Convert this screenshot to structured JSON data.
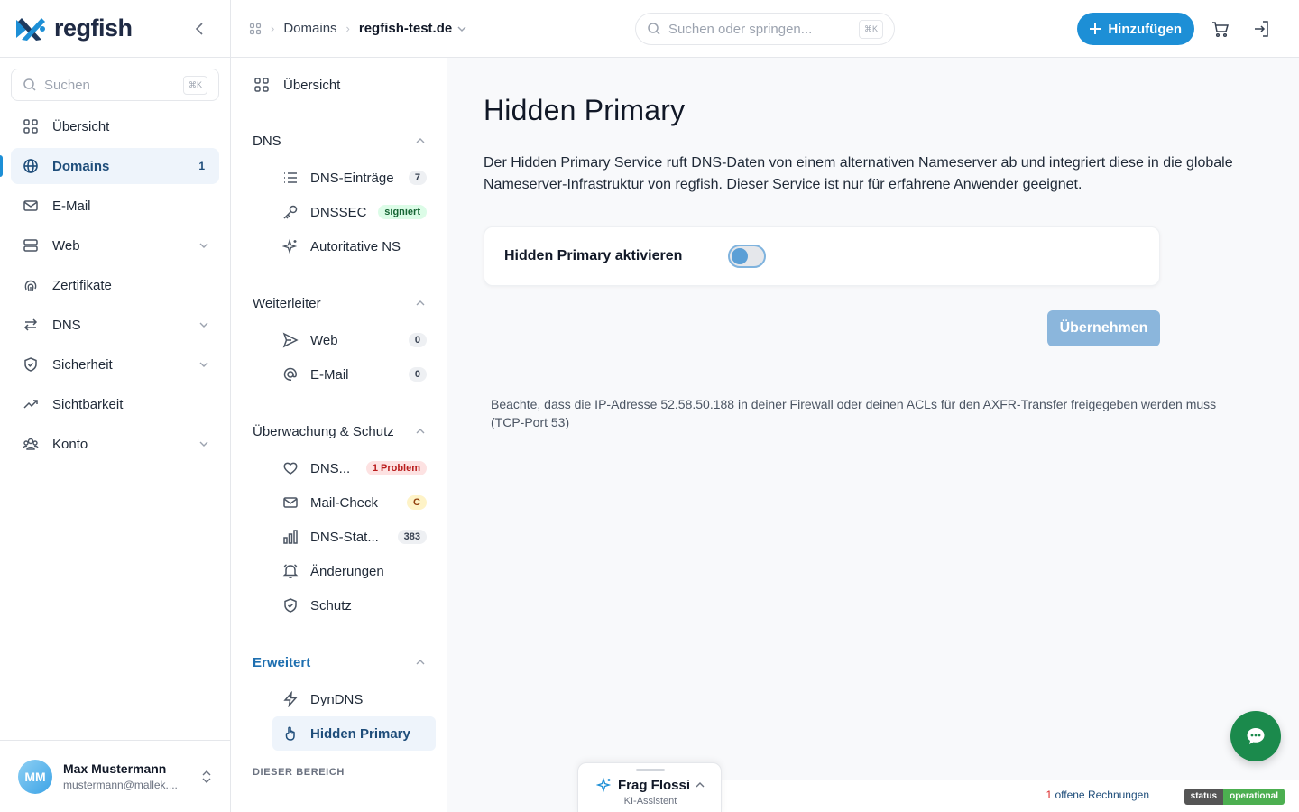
{
  "brand": {
    "name": "regfish"
  },
  "sidebar": {
    "search_placeholder": "Suchen",
    "search_shortcut": "⌘K",
    "items": [
      {
        "label": "Übersicht",
        "icon": "grid-icon"
      },
      {
        "label": "Domains",
        "icon": "globe-icon",
        "count": "1",
        "active": true
      },
      {
        "label": "E-Mail",
        "icon": "mail-icon"
      },
      {
        "label": "Web",
        "icon": "server-icon",
        "expandable": true
      },
      {
        "label": "Zertifikate",
        "icon": "fingerprint-icon"
      },
      {
        "label": "DNS",
        "icon": "arrows-icon",
        "expandable": true
      },
      {
        "label": "Sicherheit",
        "icon": "shield-icon",
        "expandable": true
      },
      {
        "label": "Sichtbarkeit",
        "icon": "trend-icon"
      },
      {
        "label": "Konto",
        "icon": "users-icon",
        "expandable": true
      }
    ]
  },
  "user": {
    "initials": "MM",
    "name": "Max Mustermann",
    "email": "mustermann@mallek...."
  },
  "topbar": {
    "breadcrumb": [
      "Domains",
      "regfish-test.de"
    ],
    "search_placeholder": "Suchen oder springen...",
    "search_shortcut": "⌘K",
    "add_label": "Hinzufügen"
  },
  "subnav": {
    "overview": "Übersicht",
    "sections": [
      {
        "title": "DNS",
        "items": [
          {
            "label": "DNS-Einträge",
            "badge": "7",
            "badge_style": "gray",
            "icon": "list-icon"
          },
          {
            "label": "DNSSEC",
            "badge": "signiert",
            "badge_style": "green",
            "icon": "key-icon"
          },
          {
            "label": "Autoritative NS",
            "icon": "sparkle-icon"
          }
        ]
      },
      {
        "title": "Weiterleiter",
        "items": [
          {
            "label": "Web",
            "badge": "0",
            "badge_style": "gray",
            "icon": "send-icon"
          },
          {
            "label": "E-Mail",
            "badge": "0",
            "badge_style": "gray",
            "icon": "at-icon"
          }
        ]
      },
      {
        "title": "Überwachung & Schutz",
        "items": [
          {
            "label": "DNS...",
            "badge": "1 Problem",
            "badge_style": "red",
            "icon": "heart-icon"
          },
          {
            "label": "Mail-Check",
            "badge": "C",
            "badge_style": "yellow",
            "icon": "mail-icon"
          },
          {
            "label": "DNS-Stat...",
            "badge": "383",
            "badge_style": "gray",
            "icon": "bar-chart-icon"
          },
          {
            "label": "Änderungen",
            "icon": "bell-icon"
          },
          {
            "label": "Schutz",
            "icon": "shield-check-icon"
          }
        ]
      },
      {
        "title": "Erweitert",
        "items": [
          {
            "label": "DynDNS",
            "icon": "bolt-icon"
          },
          {
            "label": "Hidden Primary",
            "icon": "pointer-icon",
            "active": true
          }
        ]
      }
    ],
    "footer_label": "DIESER BEREICH"
  },
  "main": {
    "title": "Hidden Primary",
    "description": "Der Hidden Primary Service ruft DNS-Daten von einem alternativen Nameserver ab und integriert diese in die globale Nameserver-Infrastruktur von regfish. Dieser Service ist nur für erfahrene Anwender geeignet.",
    "toggle_label": "Hidden Primary aktivieren",
    "toggle_on": false,
    "apply_label": "Übernehmen",
    "note": "Beachte, dass die IP-Adresse 52.58.50.188 in deiner Firewall oder deinen ACLs für den AXFR-Transfer freigegeben werden muss (TCP-Port 53)"
  },
  "assistant": {
    "title": "Frag Flossi",
    "subtitle": "KI-Assistent"
  },
  "footer": {
    "invoice_count": "1",
    "invoice_text": " offene Rechnungen",
    "status_label": "status",
    "status_value": "operational"
  },
  "colors": {
    "accent": "#1d8fd6",
    "chat": "#1b8a4c",
    "status_ok": "#4caf50"
  }
}
